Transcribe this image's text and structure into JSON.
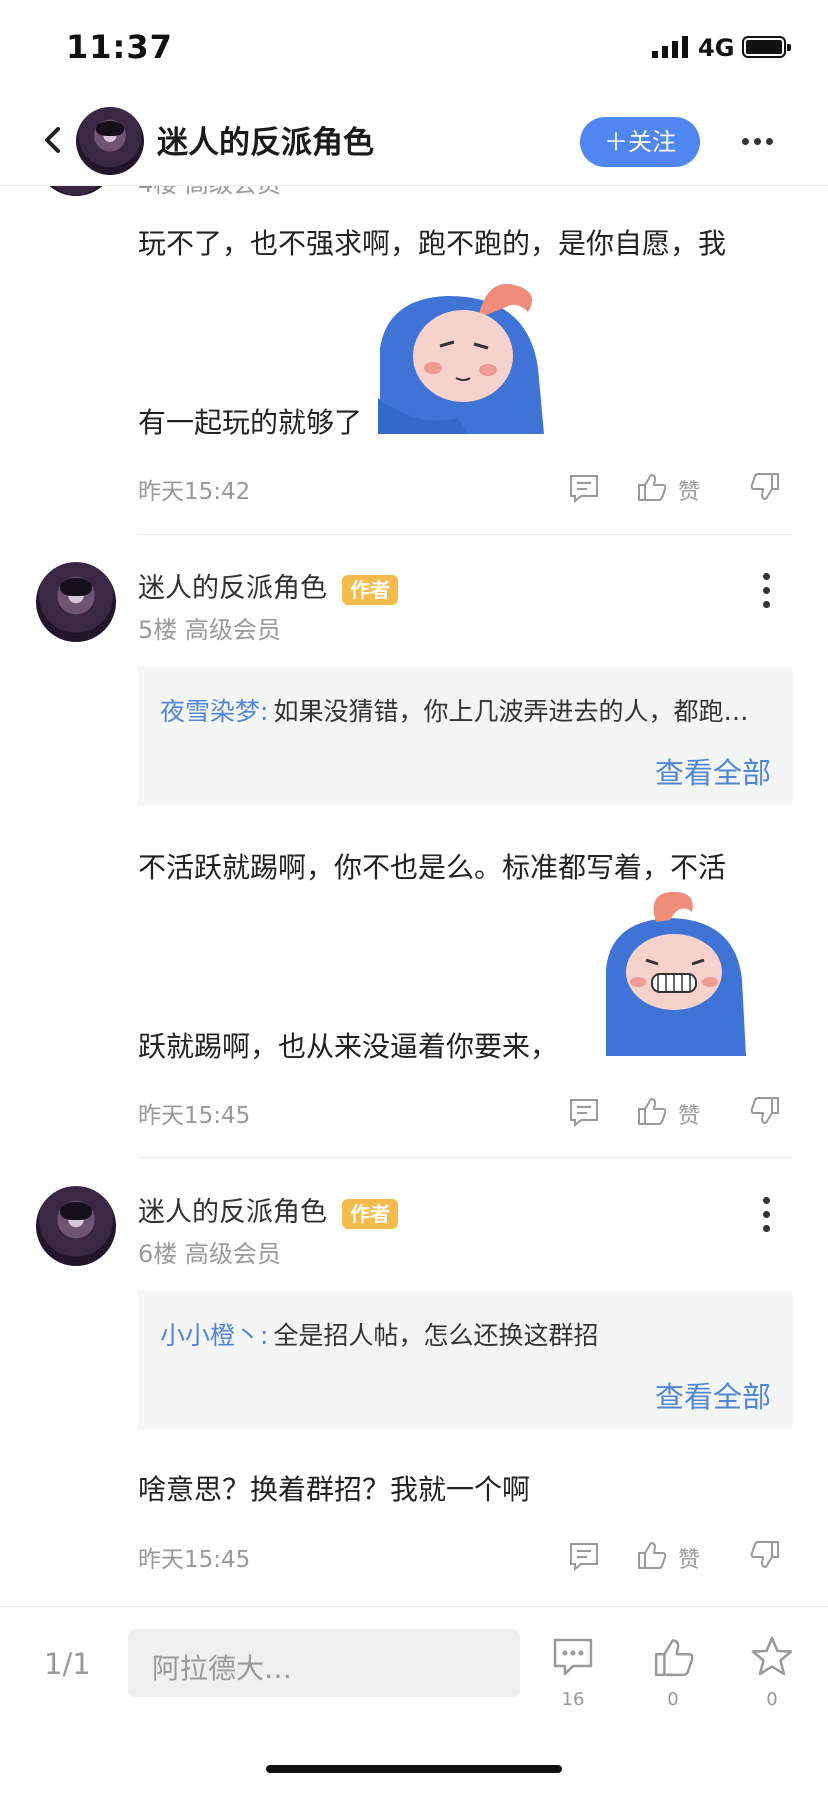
{
  "status_bar": {
    "time": "11:37",
    "network": "4G"
  },
  "header": {
    "title": "迷人的反派角色",
    "follow_label": "＋关注"
  },
  "posts": [
    {
      "partial_meta": "4楼 高级会员",
      "text_line1": "玩不了，也不强求啊，跑不跑的，是你自愿，我",
      "text_line2": "有一起玩的就够了",
      "time": "昨天15:42",
      "like_label": "赞"
    },
    {
      "author": "迷人的反派角色",
      "badge": "作者",
      "meta": "5楼 高级会员",
      "quote_user": "夜雪染梦:",
      "quote_text": "如果没猜错，你上几波弄进去的人，都跑…",
      "view_all": "查看全部",
      "text_line1": "不活跃就踢啊，你不也是么。标准都写着，不活",
      "text_line2": "跃就踢啊，也从来没逼着你要来，",
      "time": "昨天15:45",
      "like_label": "赞"
    },
    {
      "author": "迷人的反派角色",
      "badge": "作者",
      "meta": "6楼 高级会员",
      "quote_user": "小小橙丶:",
      "quote_text": "全是招人帖，怎么还换这群招",
      "view_all": "查看全部",
      "text_line1": "啥意思？换着群招？我就一个啊",
      "time": "昨天15:45",
      "like_label": "赞"
    }
  ],
  "bottom_bar": {
    "page": "1/1",
    "reply_placeholder": "阿拉德大…",
    "comment_count": "16",
    "like_count": "0",
    "favorite_count": "0"
  },
  "colors": {
    "accent": "#4f86f0",
    "link": "#4f86d6",
    "badge": "#f6ba4b"
  }
}
